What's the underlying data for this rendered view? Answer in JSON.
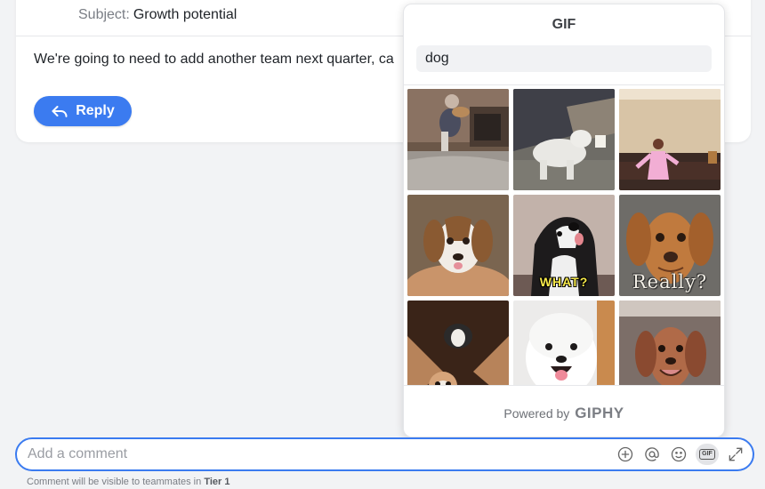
{
  "email": {
    "subject_label": "Subject:",
    "subject_value": "Growth potential",
    "body": "We're going to need to add another team next quarter, ca",
    "reply_label": "Reply"
  },
  "gif_panel": {
    "title": "GIF",
    "search_value": "dog",
    "tiles": [
      {
        "name": "gif-dog-jumping-living-room",
        "caption": ""
      },
      {
        "name": "gif-white-dog-running",
        "caption": ""
      },
      {
        "name": "gif-person-pink-dancing",
        "caption": ""
      },
      {
        "name": "gif-beagle-puppy-blanket",
        "caption": ""
      },
      {
        "name": "gif-black-white-dog-what",
        "caption": "WHAT?"
      },
      {
        "name": "gif-brown-dog-really",
        "caption": "Really?"
      },
      {
        "name": "gif-beagle-peeking",
        "caption": ""
      },
      {
        "name": "gif-samoyed-smiling",
        "caption": ""
      },
      {
        "name": "gif-dachshund-smiling",
        "caption": ""
      }
    ],
    "powered_prefix": "Powered by",
    "powered_brand": "GIPHY"
  },
  "comment": {
    "placeholder": "Add a comment",
    "gif_badge": "GIF",
    "tools": [
      "plus-circle-icon",
      "at-icon",
      "smiley-icon",
      "gif-icon",
      "expand-icon"
    ],
    "note_prefix": "Comment will be visible to teammates in",
    "note_team": "Tier 1"
  },
  "colors": {
    "accent": "#3b7bf0",
    "background": "#f2f3f5"
  }
}
